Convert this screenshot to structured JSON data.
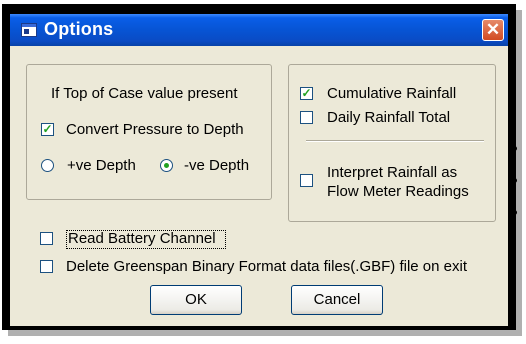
{
  "window": {
    "title": "Options",
    "close_glyph": "✕"
  },
  "left_group": {
    "heading": "If Top of Case value present",
    "convert_checkbox": {
      "label": "Convert Pressure to Depth",
      "checked": true
    },
    "radios": [
      {
        "label": "+ve Depth",
        "selected": false
      },
      {
        "label": "-ve Depth",
        "selected": true
      }
    ]
  },
  "right_group": {
    "cumulative_rainfall": {
      "label": "Cumulative Rainfall",
      "checked": true
    },
    "daily_rainfall_total": {
      "label": "Daily Rainfall Total",
      "checked": false
    },
    "interpret_rainfall": {
      "label_line1": "Interpret Rainfall as",
      "label_line2": "Flow Meter Readings",
      "checked": false
    }
  },
  "read_battery": {
    "label": "Read Battery Channel",
    "checked": false
  },
  "delete_gbf": {
    "label": "Delete Greenspan Binary Format data files(.GBF) file on exit",
    "checked": false
  },
  "buttons": {
    "ok": "OK",
    "cancel": "Cancel"
  },
  "check_glyph": "✓",
  "icons": [
    "app-icon",
    "close-icon"
  ],
  "colors": {
    "titlebar": "#0754d4",
    "dialog_bg": "#ece9d8",
    "check_mark": "#21a121",
    "close_button": "#d24a22"
  }
}
